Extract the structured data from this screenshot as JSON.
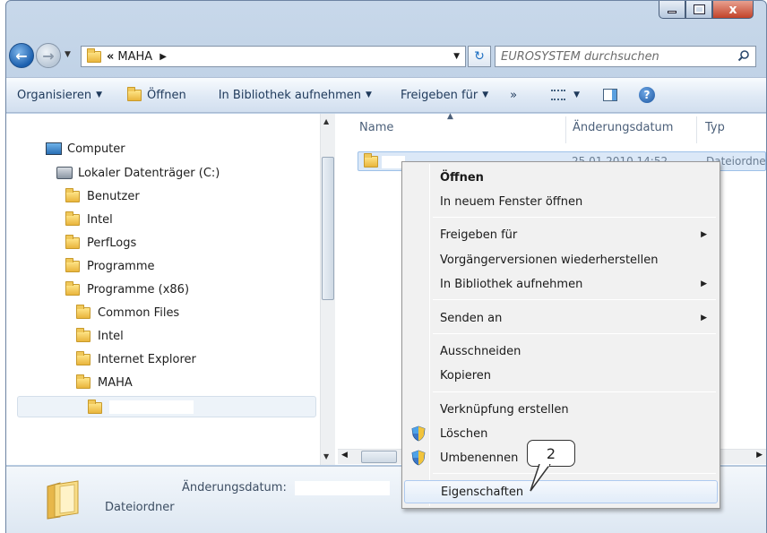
{
  "window": {
    "caption_buttons": [
      "minimize-icon",
      "maximize-icon",
      "close-icon"
    ],
    "close_glyph": "x"
  },
  "nav": {
    "breadcrumb_prefix": "«",
    "path": "MAHA",
    "search_placeholder": "EUROSYSTEM durchsuchen"
  },
  "toolbar": {
    "organize": "Organisieren",
    "open": "Öffnen",
    "include_library": "In Bibliothek aufnehmen",
    "share": "Freigeben für",
    "more": "»"
  },
  "tree": {
    "computer": "Computer",
    "drive": "Lokaler Datenträger (C:)",
    "folders": [
      "Benutzer",
      "Intel",
      "PerfLogs",
      "Programme",
      "Programme (x86)"
    ],
    "subfolders": [
      "Common Files",
      "Intel",
      "Internet Explorer",
      "MAHA"
    ]
  },
  "columns": {
    "name": "Name",
    "date": "Änderungsdatum",
    "type": "Typ"
  },
  "file": {
    "date": "25.01.2010 14:52",
    "type": "Dateiordner"
  },
  "details": {
    "date_label": "Änderungsdatum:",
    "type": "Dateiordner"
  },
  "context_menu": {
    "open": "Öffnen",
    "open_new_window": "In neuem Fenster öffnen",
    "share": "Freigeben für",
    "restore": "Vorgängerversionen wiederherstellen",
    "library": "In Bibliothek aufnehmen",
    "send_to": "Senden an",
    "cut": "Ausschneiden",
    "copy": "Kopieren",
    "shortcut": "Verknüpfung erstellen",
    "delete": "Löschen",
    "rename": "Umbenennen",
    "properties": "Eigenschaften"
  },
  "callout": {
    "number": "2"
  },
  "colors": {
    "accent": "#1e395b",
    "selection": "#dbe8f7",
    "close_button": "#c2432a"
  }
}
